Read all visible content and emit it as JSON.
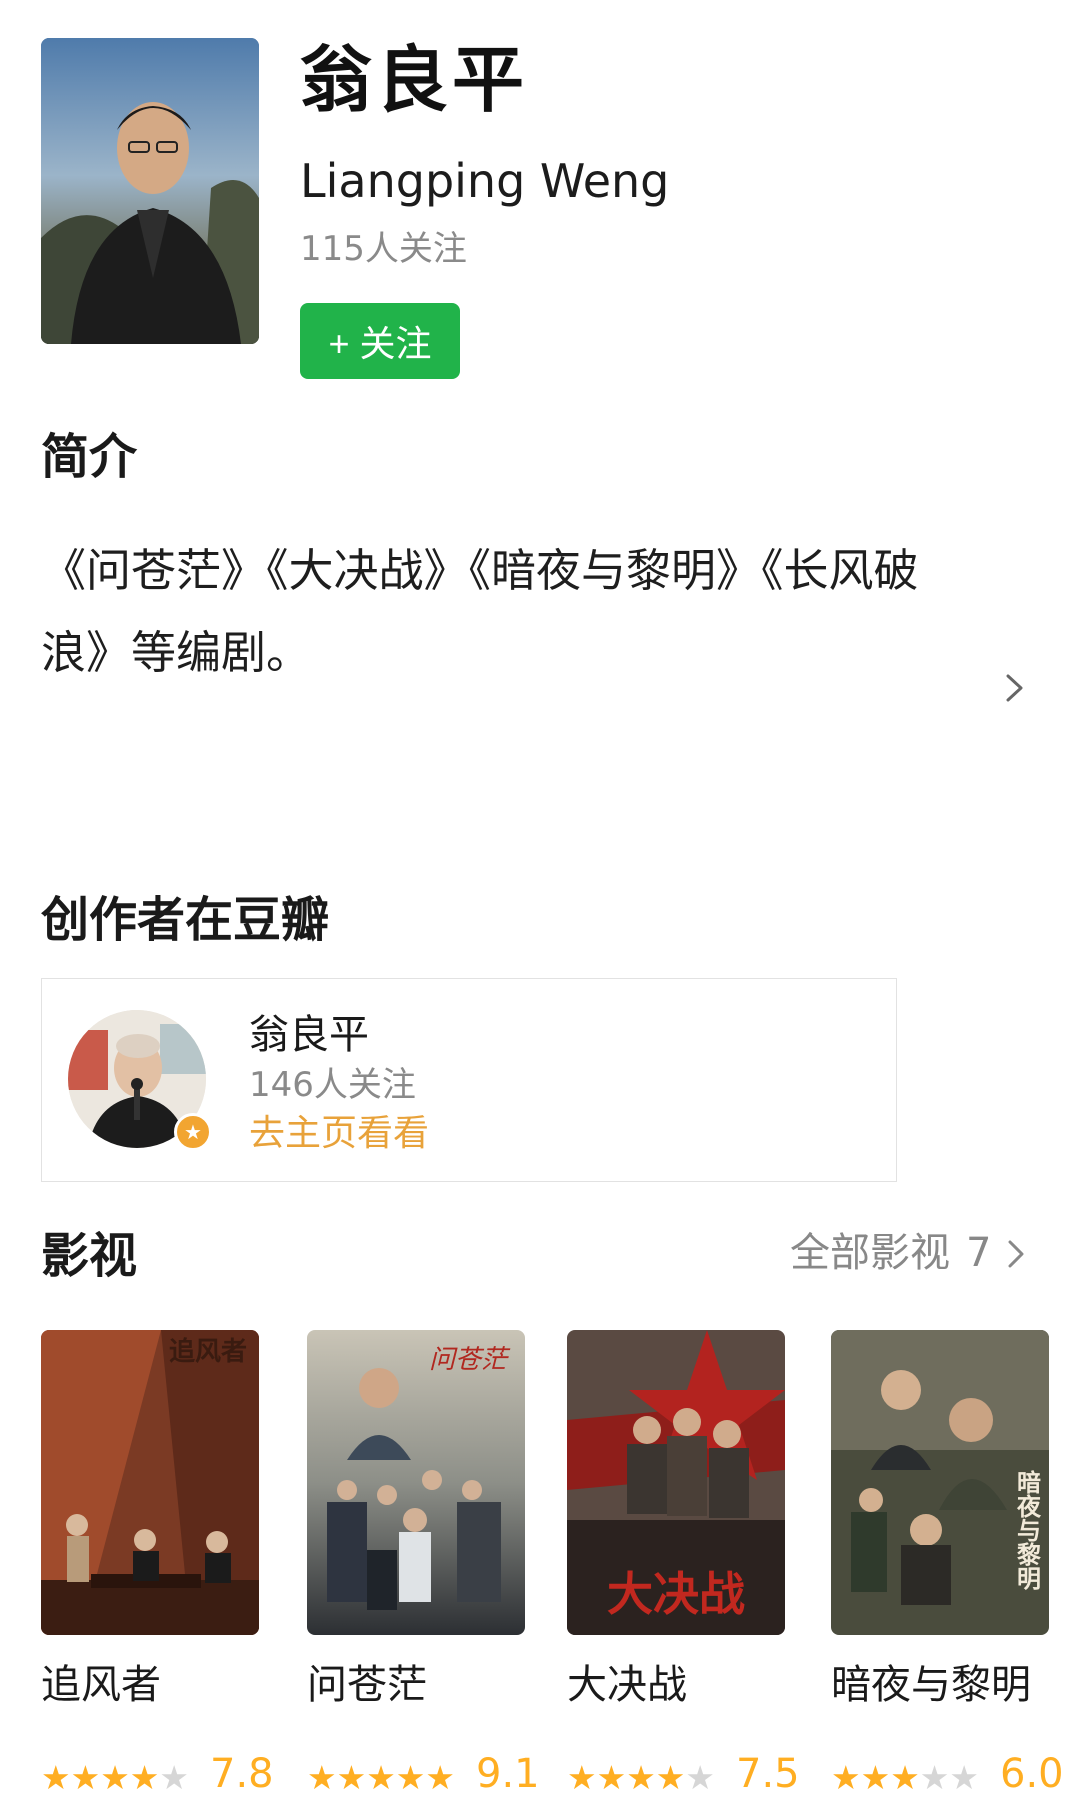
{
  "profile": {
    "name_cn": "翁良平",
    "name_en": "Liangping Weng",
    "followers": "115人关注",
    "follow_button": "+ 关注"
  },
  "intro": {
    "title": "简介",
    "text": "《问苍茫》《大决战》《暗夜与黎明》《长风破浪》等编剧。"
  },
  "creator": {
    "title": "创作者在豆瓣",
    "name": "翁良平",
    "followers": "146人关注",
    "link": "去主页看看"
  },
  "works": {
    "title": "影视",
    "all_label": "全部影视",
    "count": "7",
    "items": [
      {
        "title": "追风者",
        "score": "7.8",
        "stars_filled": 4,
        "poster_text": "追风者"
      },
      {
        "title": "问苍茫",
        "score": "9.1",
        "stars_filled": 4.5,
        "poster_text": "问苍茫"
      },
      {
        "title": "大决战",
        "score": "7.5",
        "stars_filled": 4,
        "poster_text": "大决战"
      },
      {
        "title": "暗夜与黎明",
        "score": "6.0",
        "stars_filled": 3,
        "poster_text": "暗夜与黎明"
      }
    ]
  },
  "colors": {
    "follow_green": "#21b34a",
    "rating_orange": "#ffae22",
    "link_orange": "#e8a23a"
  }
}
